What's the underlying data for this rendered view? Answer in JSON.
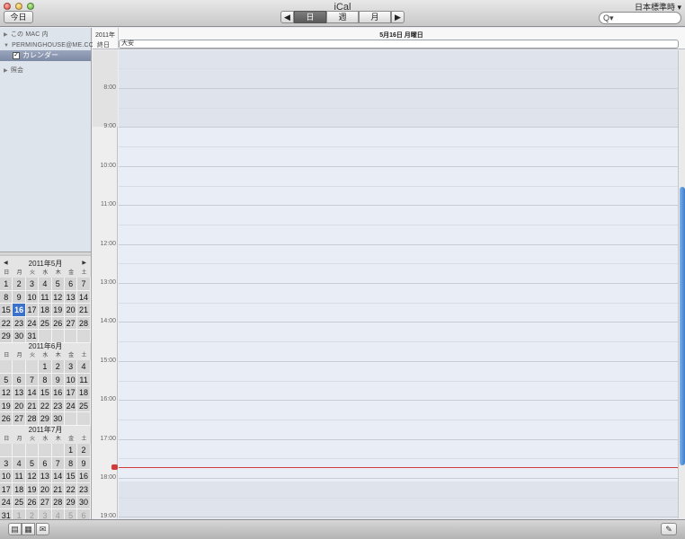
{
  "window": {
    "title": "iCal",
    "timezone": "日本標準時 ▾"
  },
  "toolbar": {
    "today": "今日",
    "prev": "◀",
    "next": "▶",
    "views": [
      "日",
      "週",
      "月"
    ],
    "search_icon": "Q▾"
  },
  "sidebar": {
    "section_this_mac": "この MAC 内",
    "section_account": "PERMINGHOUSE@ME.COM",
    "calendar_item": "カレンダー",
    "calendar_checked": "✓",
    "section_subscribed": "照会"
  },
  "mini_cals": {
    "prev_arrow": "◀",
    "next_arrow": "▶",
    "weekdays": [
      "日",
      "月",
      "火",
      "水",
      "木",
      "金",
      "土"
    ],
    "months": [
      {
        "title": "2011年5月",
        "days": [
          "1",
          "2",
          "3",
          "4",
          "5",
          "6",
          "7",
          "8",
          "9",
          "10",
          "11",
          "12",
          "13",
          "14",
          "15",
          "16",
          "17",
          "18",
          "19",
          "20",
          "21",
          "22",
          "23",
          "24",
          "25",
          "26",
          "27",
          "28",
          "29",
          "30",
          "31",
          "",
          "",
          "",
          ""
        ],
        "today": "16"
      },
      {
        "title": "2011年6月",
        "days": [
          "",
          "",
          "",
          "1",
          "2",
          "3",
          "4",
          "5",
          "6",
          "7",
          "8",
          "9",
          "10",
          "11",
          "12",
          "13",
          "14",
          "15",
          "16",
          "17",
          "18",
          "19",
          "20",
          "21",
          "22",
          "23",
          "24",
          "25",
          "26",
          "27",
          "28",
          "29",
          "30",
          "",
          ""
        ],
        "today": ""
      },
      {
        "title": "2011年7月",
        "days": [
          "",
          "",
          "",
          "",
          "",
          "1",
          "2",
          "3",
          "4",
          "5",
          "6",
          "7",
          "8",
          "9",
          "10",
          "11",
          "12",
          "13",
          "14",
          "15",
          "16",
          "17",
          "18",
          "19",
          "20",
          "21",
          "22",
          "23",
          "24",
          "25",
          "26",
          "27",
          "28",
          "29",
          "30",
          "31",
          "1",
          "2",
          "3",
          "4",
          "5",
          "6"
        ],
        "today": ""
      }
    ]
  },
  "dayview": {
    "year": "2011年",
    "date": "5月16日 月曜日",
    "allday_label": "終日",
    "allday_event": "大安",
    "hours": [
      "8:00",
      "9:00",
      "10:00",
      "11:00",
      "12:00",
      "13:00",
      "14:00",
      "15:00",
      "16:00",
      "17:00",
      "18:00",
      "19:00"
    ]
  },
  "bottom": {
    "btn1": "▤",
    "btn2": "▦",
    "btn3": "✉",
    "pin": "✎"
  },
  "colors": {
    "accent": "#3b71c9",
    "now_line": "#d23b3b",
    "selection": "#8592ad"
  }
}
